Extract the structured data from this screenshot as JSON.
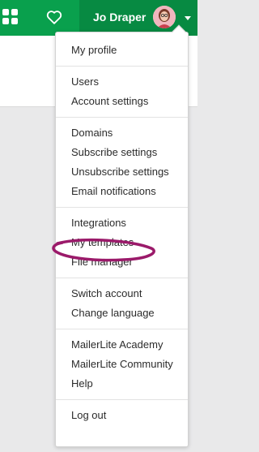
{
  "topbar": {
    "user_name": "Jo Draper",
    "brand_color": "#09a04d",
    "icons": [
      "apps-grid-icon",
      "heart-icon",
      "chevron-down-icon"
    ]
  },
  "menu": {
    "groups": [
      {
        "items": [
          {
            "label": "My profile"
          }
        ]
      },
      {
        "items": [
          {
            "label": "Users"
          },
          {
            "label": "Account settings"
          }
        ]
      },
      {
        "items": [
          {
            "label": "Domains"
          },
          {
            "label": "Subscribe settings"
          },
          {
            "label": "Unsubscribe settings"
          },
          {
            "label": "Email notifications"
          }
        ]
      },
      {
        "items": [
          {
            "label": "Integrations"
          },
          {
            "label": "My templates"
          },
          {
            "label": "File manager"
          }
        ]
      },
      {
        "items": [
          {
            "label": "Switch account"
          },
          {
            "label": "Change language"
          }
        ]
      },
      {
        "items": [
          {
            "label": "MailerLite Academy"
          },
          {
            "label": "MailerLite Community"
          },
          {
            "label": "Help"
          }
        ]
      },
      {
        "items": [
          {
            "label": "Log out"
          }
        ]
      }
    ],
    "annotation_color": "#9b1a6a"
  }
}
